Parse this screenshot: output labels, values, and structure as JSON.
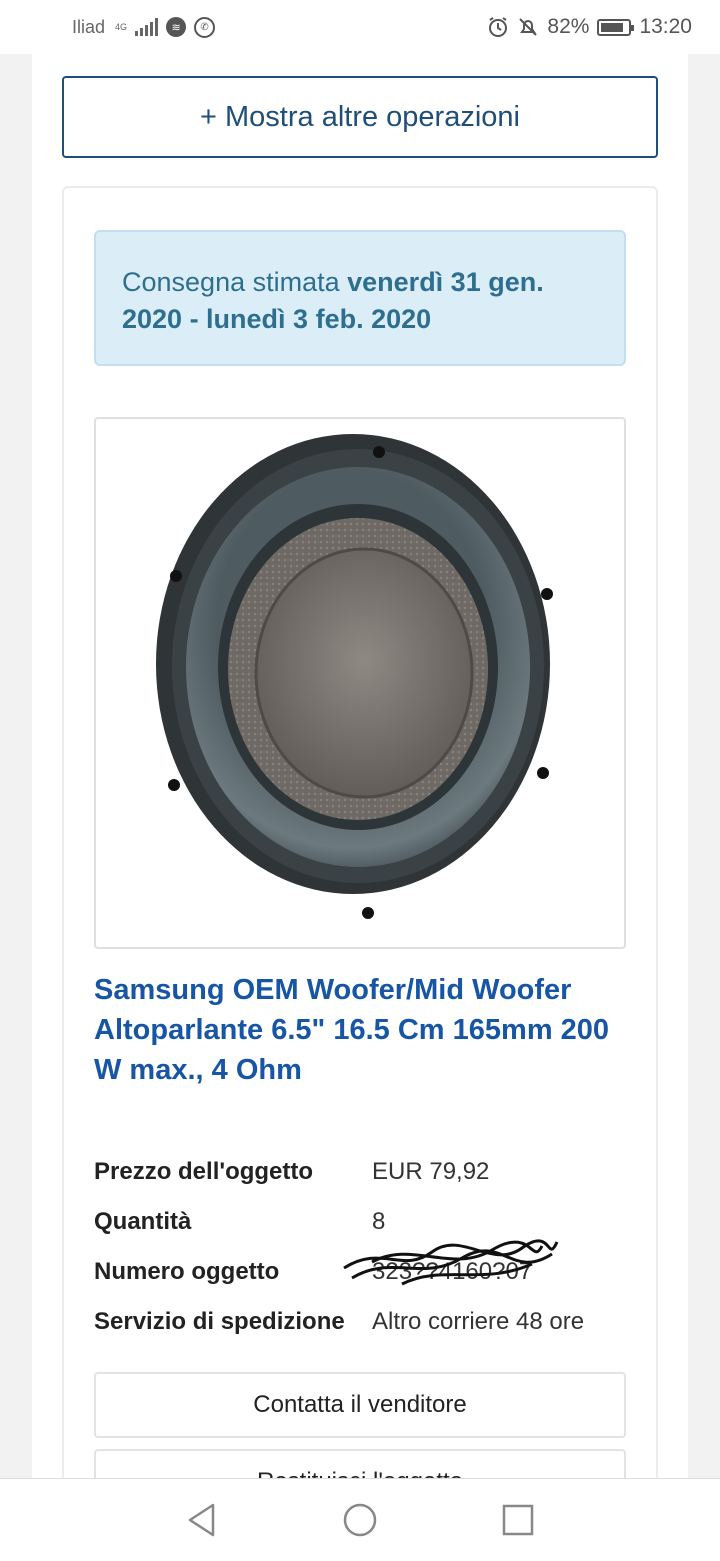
{
  "status_bar": {
    "carrier": "Iliad",
    "network_type": "4G",
    "battery_percent": "82%",
    "battery_level": 0.82,
    "time": "13:20"
  },
  "actions": {
    "more_operations": "+ Mostra altre operazioni",
    "contact_seller": "Contatta il venditore",
    "return_item": "Restituisci l'oggetto"
  },
  "delivery": {
    "label": "Consegna stimata",
    "range": "venerdì 31 gen. 2020 - lunedì 3 feb. 2020"
  },
  "product": {
    "title": "Samsung OEM Woofer/Mid Woofer Altoparlante 6.5\" 16.5 Cm 165mm 200 W max., 4 Ohm",
    "image_icon": "woofer-speaker-image"
  },
  "details": [
    {
      "label": "Prezzo dell'oggetto",
      "value": "EUR 79,92"
    },
    {
      "label": "Quantità",
      "value": "8"
    },
    {
      "label": "Numero oggetto",
      "value": "323??4160?07"
    },
    {
      "label": "Servizio di spedizione",
      "value": "Altro corriere 48 ore"
    }
  ],
  "colors": {
    "link_blue": "#1755a5",
    "button_border": "#1f4e79",
    "delivery_bg": "#dbeef7"
  }
}
